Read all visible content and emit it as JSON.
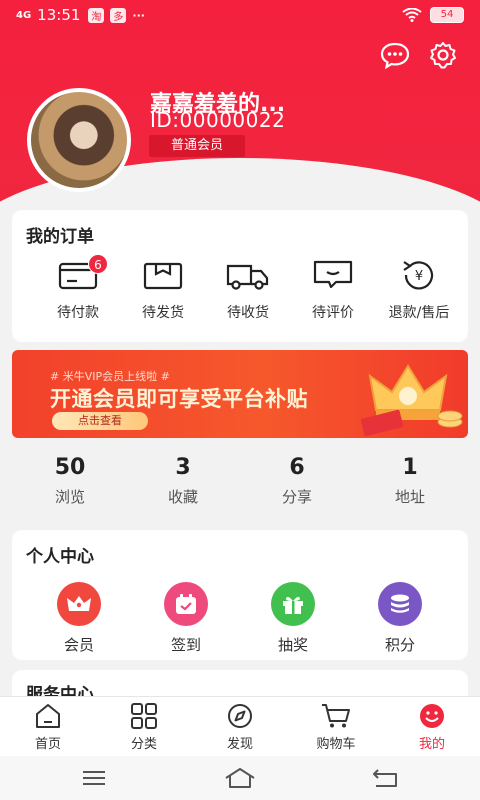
{
  "status": {
    "signal": "4G",
    "time": "13:51",
    "apps": [
      "淘",
      "多"
    ],
    "more": "···",
    "battery": "54"
  },
  "profile": {
    "name": "嘉嘉羞羞的...",
    "id": "ID:00000022",
    "level": "普通会员"
  },
  "orders": {
    "title": "我的订单",
    "items": [
      {
        "label": "待付款",
        "icon": "wallet-icon",
        "badge": "6"
      },
      {
        "label": "待发货",
        "icon": "box-icon"
      },
      {
        "label": "待收货",
        "icon": "truck-icon"
      },
      {
        "label": "待评价",
        "icon": "comment-icon"
      },
      {
        "label": "退款/售后",
        "icon": "refund-icon"
      }
    ]
  },
  "banner": {
    "small": "# 米牛VIP会员上线啦 #",
    "big": "开通会员即可享受平台补贴",
    "button": "点击查看"
  },
  "stats": [
    {
      "value": "50",
      "label": "浏览"
    },
    {
      "value": "3",
      "label": "收藏"
    },
    {
      "value": "6",
      "label": "分享"
    },
    {
      "value": "1",
      "label": "地址"
    }
  ],
  "center": {
    "title": "个人中心",
    "items": [
      {
        "label": "会员",
        "icon": "crown-icon",
        "color": "#f0483e"
      },
      {
        "label": "签到",
        "icon": "calendar-icon",
        "color": "#ee4a7e"
      },
      {
        "label": "抽奖",
        "icon": "gift-icon",
        "color": "#41c04f"
      },
      {
        "label": "积分",
        "icon": "coins-icon",
        "color": "#7b57c6"
      }
    ]
  },
  "service": {
    "title": "服务中心"
  },
  "tabbar": [
    {
      "label": "首页",
      "icon": "home-icon"
    },
    {
      "label": "分类",
      "icon": "grid-icon"
    },
    {
      "label": "发现",
      "icon": "compass-icon"
    },
    {
      "label": "购物车",
      "icon": "cart-icon"
    },
    {
      "label": "我的",
      "icon": "profile-icon",
      "active": true
    }
  ],
  "colors": {
    "brand": "#f0273f",
    "background": "#f2f2f2"
  }
}
